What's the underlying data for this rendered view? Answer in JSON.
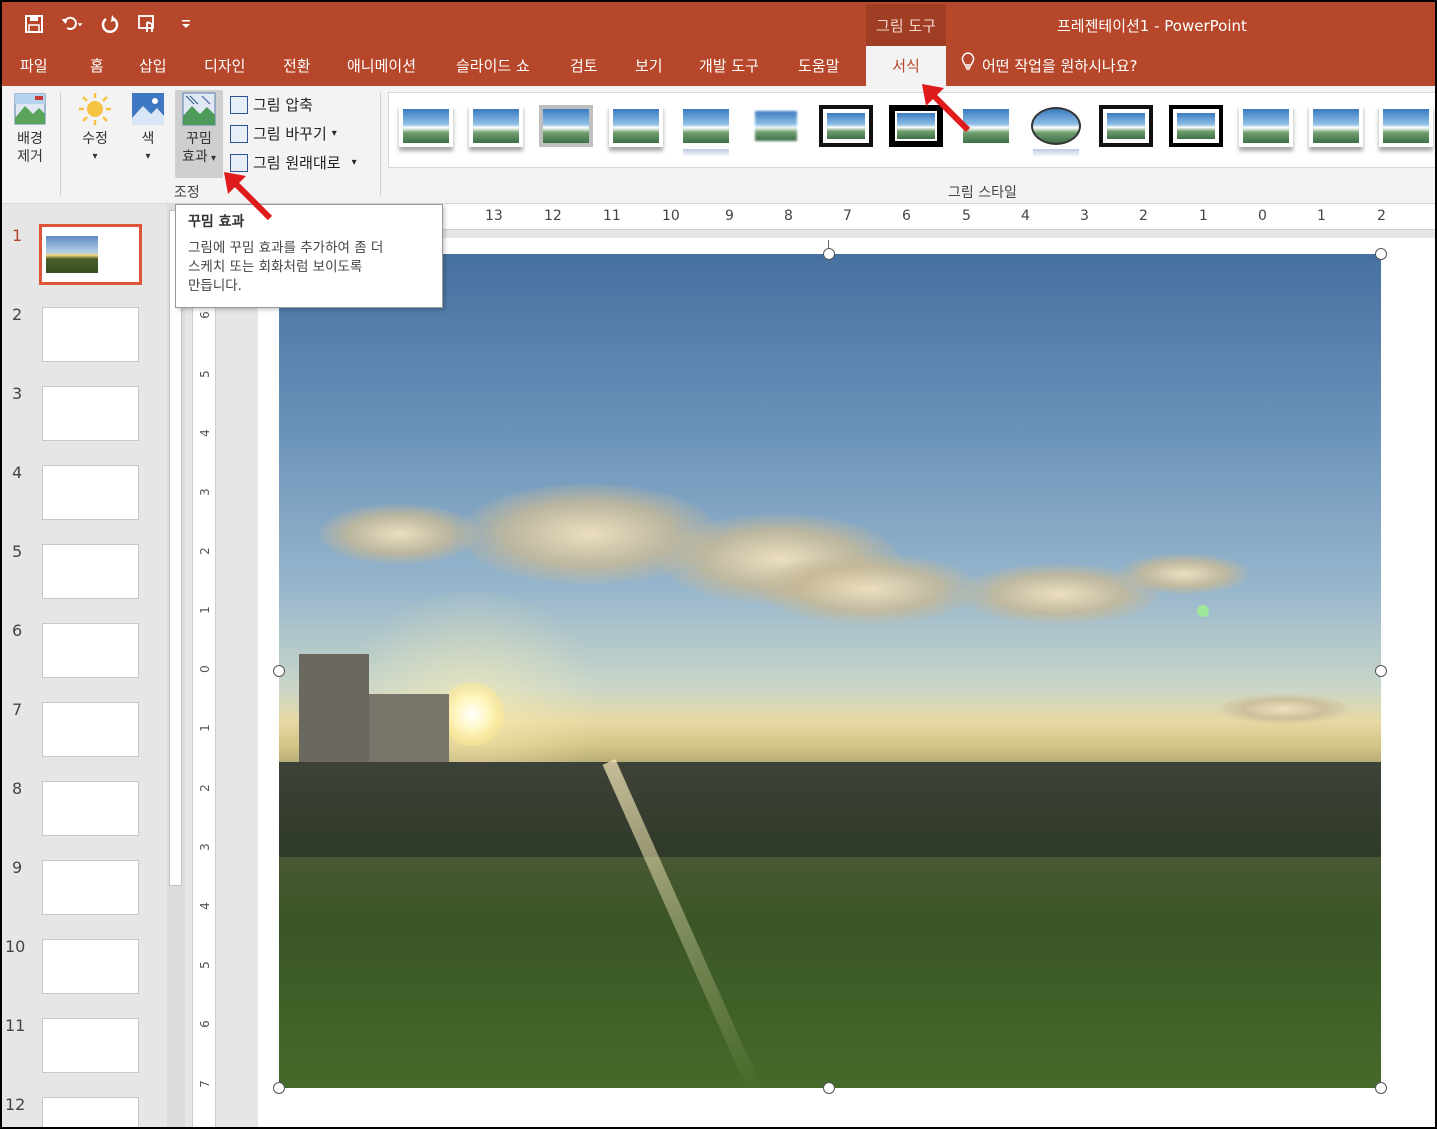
{
  "colors": {
    "accent": "#b7472a",
    "arrow": "#e01b1b",
    "selection": "#e0553a"
  },
  "quick_access": [
    "save-icon",
    "undo-icon",
    "redo-icon",
    "touch-mode-icon",
    "customize-icon"
  ],
  "context_tab_header": "그림 도구",
  "window_title": "프레젠테이션1  -  PowerPoint",
  "tabs": [
    "파일",
    "홈",
    "삽입",
    "디자인",
    "전환",
    "애니메이션",
    "슬라이드 쇼",
    "검토",
    "보기",
    "개발 도구",
    "도움말",
    "서식"
  ],
  "active_tab": "서식",
  "tell_me": "어떤 작업을 원하시나요?",
  "ribbon": {
    "remove_bg": [
      "배경",
      "제거"
    ],
    "corrections": "수정",
    "color": "색",
    "artistic": [
      "꾸밈",
      "효과"
    ],
    "compress": "그림 압축",
    "change": "그림 바꾸기",
    "reset": "그림 원래대로",
    "group_adjust": "조정",
    "group_styles": "그림 스타일"
  },
  "tooltip": {
    "title": "꾸밈 효과",
    "body": [
      "그림에 꾸밈 효과를 추가하여 좀 더",
      "스케치 또는 회화처럼 보이도록",
      "만듭니다."
    ]
  },
  "slides": [
    "1",
    "2",
    "3",
    "4",
    "5",
    "6",
    "7",
    "8",
    "9",
    "10",
    "11",
    "12"
  ],
  "active_slide": "1",
  "hruler_labels": [
    "13",
    "12",
    "11",
    "10",
    "9",
    "8",
    "7",
    "6",
    "5",
    "4",
    "3",
    "2",
    "1",
    "0",
    "1",
    "2"
  ],
  "vruler_labels": [
    "6",
    "5",
    "4",
    "3",
    "2",
    "1",
    "0",
    "1",
    "2",
    "3",
    "4",
    "5",
    "6",
    "7"
  ]
}
